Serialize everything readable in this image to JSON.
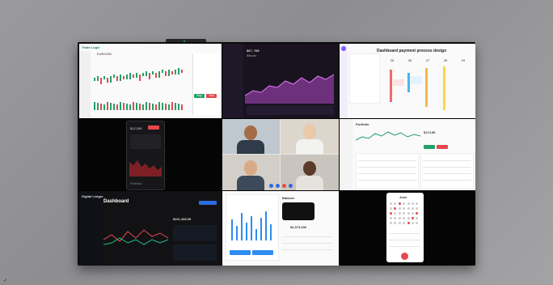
{
  "scene": {
    "corner_mark": "✓"
  },
  "trading": {
    "app": "Trade Logic",
    "pair": "EUR/USD",
    "buy": "Buy",
    "sell": "Sell"
  },
  "crypto_dark": {
    "price": "$67, 789",
    "label": "Bitcoin"
  },
  "schedule": {
    "title": "Dashboard payment process design",
    "days": [
      "26",
      "26",
      "27",
      "28",
      "29"
    ]
  },
  "mobile_wallet": {
    "balance": "$12,345",
    "tab": "Portfolio"
  },
  "video_call": {
    "participants": 4
  },
  "stock_light": {
    "title": "Portfolio",
    "price": "$174.56"
  },
  "dashboard": {
    "brand": "Digital Ledger",
    "title": "Dashboard",
    "amount": "$321,453.99"
  },
  "wallet_web": {
    "balance": "$2,373,000",
    "header": "Balance"
  },
  "calendar_app": {
    "month": "June"
  }
}
